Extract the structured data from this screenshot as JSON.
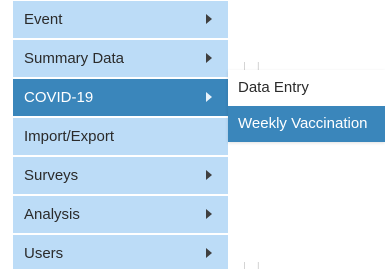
{
  "main_menu": {
    "items": [
      {
        "label": "Event",
        "has_submenu": true,
        "active": false
      },
      {
        "label": "Summary Data",
        "has_submenu": true,
        "active": false
      },
      {
        "label": "COVID-19",
        "has_submenu": true,
        "active": true
      },
      {
        "label": "Import/Export",
        "has_submenu": false,
        "active": false
      },
      {
        "label": "Surveys",
        "has_submenu": true,
        "active": false
      },
      {
        "label": "Analysis",
        "has_submenu": true,
        "active": false
      },
      {
        "label": "Users",
        "has_submenu": true,
        "active": false
      }
    ],
    "icon": "chevron-right-icon"
  },
  "submenu": {
    "parent": "COVID-19",
    "items": [
      {
        "label": "Data Entry",
        "active": false
      },
      {
        "label": "Weekly Vaccination",
        "active": true
      }
    ]
  },
  "colors": {
    "menu_background": "#bcdcf7",
    "active_background": "#3a86bb",
    "active_text": "#ffffff",
    "text": "#2b2b2b"
  }
}
